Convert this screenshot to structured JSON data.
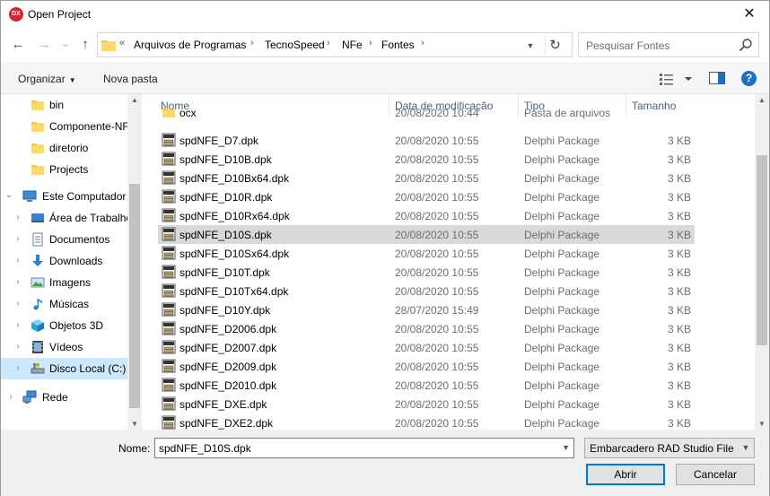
{
  "window": {
    "title": "Open Project",
    "app_icon_text": "DX",
    "close_glyph": "✕"
  },
  "navbar": {
    "back_glyph": "←",
    "forward_glyph": "→",
    "recent_glyph": "⌄",
    "up_glyph": "↑",
    "overflow_glyph": "«",
    "breadcrumbs": [
      "Arquivos de Programas",
      "TecnoSpeed",
      "NFe",
      "Fontes"
    ],
    "separator_glyph": "›",
    "refresh_glyph": "↻",
    "search_placeholder": "Pesquisar Fontes"
  },
  "toolbar": {
    "organize_label": "Organizar",
    "new_folder_label": "Nova pasta",
    "help_label": "?"
  },
  "columns": {
    "name": "Nome",
    "date": "Data de modificação",
    "type": "Tipo",
    "size": "Tamanho"
  },
  "navpane": {
    "items": [
      {
        "label": "bin",
        "icon": "folder-icon"
      },
      {
        "label": "Componente-NFe",
        "icon": "folder-icon"
      },
      {
        "label": "diretorio",
        "icon": "folder-icon"
      },
      {
        "label": "Projects",
        "icon": "folder-icon"
      },
      {
        "label": "Este Computador",
        "icon": "computer-icon"
      },
      {
        "label": "Área de Trabalho",
        "icon": "desktop-icon"
      },
      {
        "label": "Documentos",
        "icon": "documents-icon"
      },
      {
        "label": "Downloads",
        "icon": "downloads-icon"
      },
      {
        "label": "Imagens",
        "icon": "pictures-icon"
      },
      {
        "label": "Músicas",
        "icon": "music-icon"
      },
      {
        "label": "Objetos 3D",
        "icon": "objects3d-icon"
      },
      {
        "label": "Vídeos",
        "icon": "videos-icon"
      },
      {
        "label": "Disco Local (C:)",
        "icon": "drive-icon"
      },
      {
        "label": "Rede",
        "icon": "network-icon"
      }
    ]
  },
  "files": [
    {
      "name": "ocx",
      "date": "20/08/2020 10:44",
      "type": "Pasta de arquivos",
      "size": "",
      "kind": "folder"
    },
    {
      "name": "spdNFE_D7.dpk",
      "date": "20/08/2020 10:55",
      "type": "Delphi Package",
      "size": "3 KB",
      "kind": "dpk"
    },
    {
      "name": "spdNFE_D10B.dpk",
      "date": "20/08/2020 10:55",
      "type": "Delphi Package",
      "size": "3 KB",
      "kind": "dpk"
    },
    {
      "name": "spdNFE_D10Bx64.dpk",
      "date": "20/08/2020 10:55",
      "type": "Delphi Package",
      "size": "3 KB",
      "kind": "dpk"
    },
    {
      "name": "spdNFE_D10R.dpk",
      "date": "20/08/2020 10:55",
      "type": "Delphi Package",
      "size": "3 KB",
      "kind": "dpk"
    },
    {
      "name": "spdNFE_D10Rx64.dpk",
      "date": "20/08/2020 10:55",
      "type": "Delphi Package",
      "size": "3 KB",
      "kind": "dpk"
    },
    {
      "name": "spdNFE_D10S.dpk",
      "date": "20/08/2020 10:55",
      "type": "Delphi Package",
      "size": "3 KB",
      "kind": "dpk",
      "selected": true
    },
    {
      "name": "spdNFE_D10Sx64.dpk",
      "date": "20/08/2020 10:55",
      "type": "Delphi Package",
      "size": "3 KB",
      "kind": "dpk"
    },
    {
      "name": "spdNFE_D10T.dpk",
      "date": "20/08/2020 10:55",
      "type": "Delphi Package",
      "size": "3 KB",
      "kind": "dpk"
    },
    {
      "name": "spdNFE_D10Tx64.dpk",
      "date": "20/08/2020 10:55",
      "type": "Delphi Package",
      "size": "3 KB",
      "kind": "dpk"
    },
    {
      "name": "spdNFE_D10Y.dpk",
      "date": "28/07/2020 15:49",
      "type": "Delphi Package",
      "size": "3 KB",
      "kind": "dpk"
    },
    {
      "name": "spdNFE_D2006.dpk",
      "date": "20/08/2020 10:55",
      "type": "Delphi Package",
      "size": "3 KB",
      "kind": "dpk"
    },
    {
      "name": "spdNFE_D2007.dpk",
      "date": "20/08/2020 10:55",
      "type": "Delphi Package",
      "size": "3 KB",
      "kind": "dpk"
    },
    {
      "name": "spdNFE_D2009.dpk",
      "date": "20/08/2020 10:55",
      "type": "Delphi Package",
      "size": "3 KB",
      "kind": "dpk"
    },
    {
      "name": "spdNFE_D2010.dpk",
      "date": "20/08/2020 10:55",
      "type": "Delphi Package",
      "size": "3 KB",
      "kind": "dpk"
    },
    {
      "name": "spdNFE_DXE.dpk",
      "date": "20/08/2020 10:55",
      "type": "Delphi Package",
      "size": "3 KB",
      "kind": "dpk"
    },
    {
      "name": "spdNFE_DXE2.dpk",
      "date": "20/08/2020 10:55",
      "type": "Delphi Package",
      "size": "3 KB",
      "kind": "dpk"
    }
  ],
  "bottom": {
    "name_label": "Nome:",
    "name_value": "spdNFE_D10S.dpk",
    "filter_value": "Embarcadero RAD Studio File (*",
    "open_label": "Abrir",
    "cancel_label": "Cancelar"
  },
  "colors": {
    "accent": "#0078d7",
    "selection": "#cce8ff",
    "row_selected": "#d9d9d9",
    "folder": "#f2c94c"
  }
}
